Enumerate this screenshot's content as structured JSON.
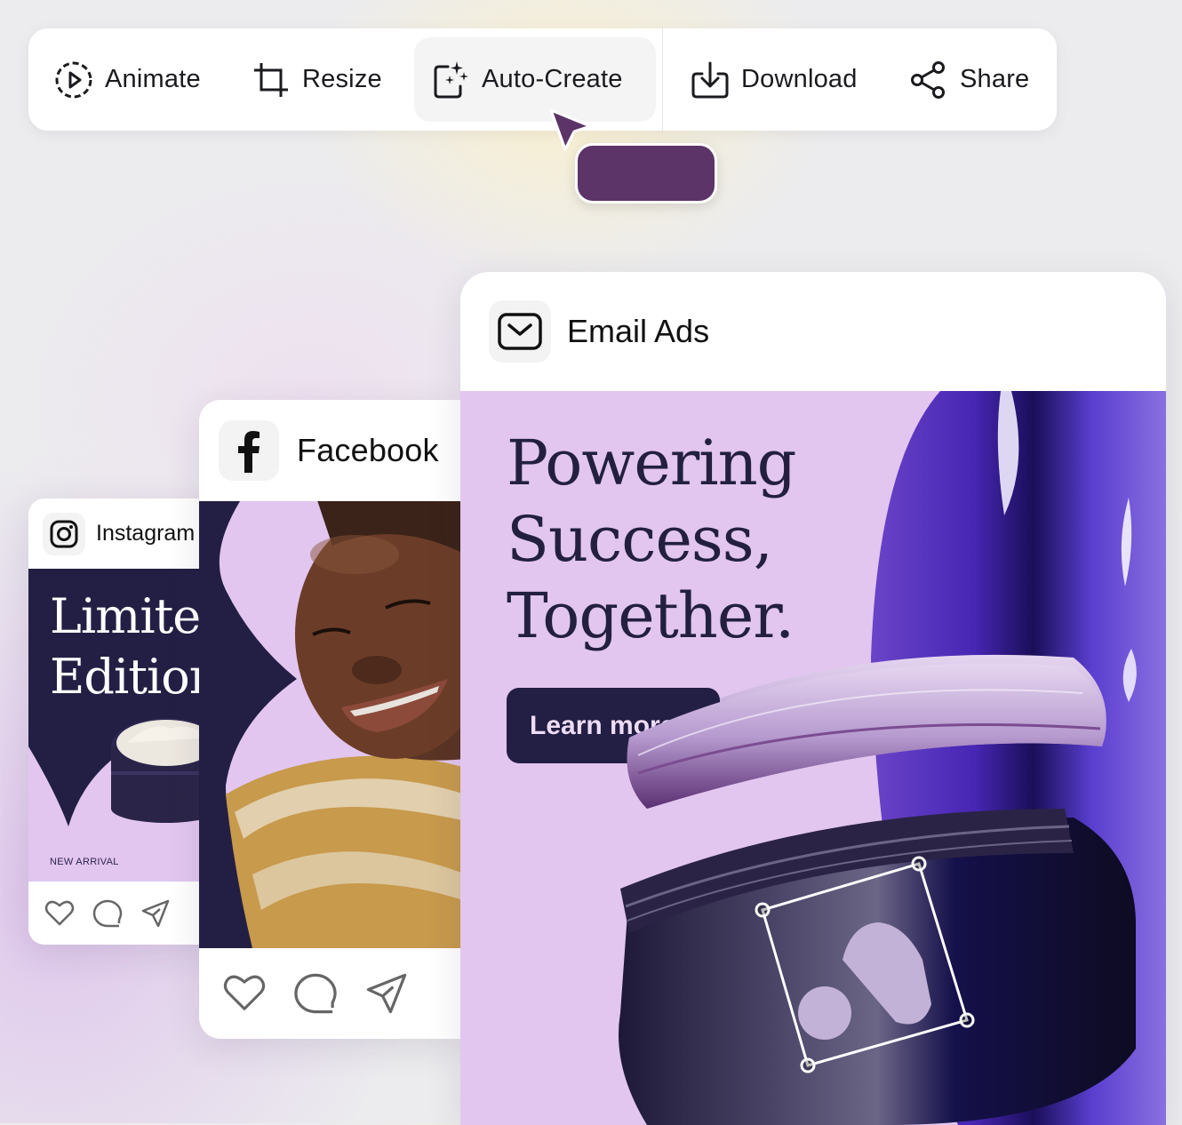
{
  "toolbar": {
    "items": [
      {
        "label": "Animate",
        "icon": "animate-play-circle-icon"
      },
      {
        "label": "Resize",
        "icon": "crop-icon"
      },
      {
        "label": "Auto-Create",
        "icon": "sparkle-frame-icon",
        "active": true
      },
      {
        "label": "Download",
        "icon": "download-icon"
      },
      {
        "label": "Share",
        "icon": "share-icon"
      }
    ]
  },
  "cursor": {
    "color": "#5c3468"
  },
  "tooltip": {
    "text": "",
    "color": "#5c3468"
  },
  "cards": {
    "instagram": {
      "label": "Instagram",
      "icon": "instagram-icon",
      "headline_line1": "Limited",
      "headline_line2": "Edition",
      "tag": "NEW ARRIVAL",
      "actions": [
        "heart-icon",
        "comment-icon",
        "send-icon"
      ]
    },
    "facebook": {
      "label": "Facebook",
      "icon": "facebook-icon",
      "actions": [
        "heart-icon",
        "comment-icon",
        "send-icon"
      ]
    },
    "email": {
      "label": "Email Ads",
      "icon": "mail-icon",
      "headline_line1": "Powering",
      "headline_line2": "Success,",
      "headline_line3": "Together.",
      "cta": "Learn more"
    }
  },
  "colors": {
    "navy": "#231f44",
    "lavender": "#e2c6ef",
    "accent_purple": "#5c3468",
    "violet_swirl": "#4b2aa8"
  }
}
